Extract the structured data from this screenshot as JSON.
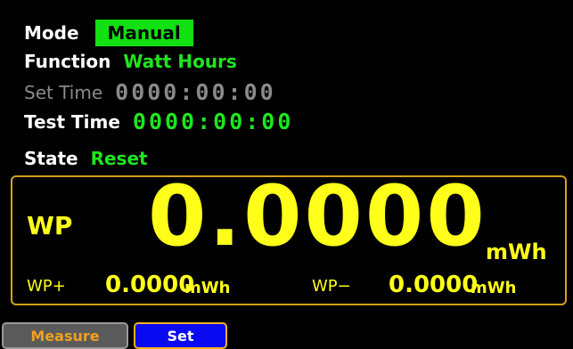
{
  "mode": {
    "label": "Mode",
    "value": "Manual"
  },
  "function": {
    "label": "Function",
    "value": "Watt Hours"
  },
  "set_time": {
    "label": "Set Time",
    "value": "0000:00:00"
  },
  "test_time": {
    "label": "Test Time",
    "value": "0000:00:00"
  },
  "state": {
    "label": "State",
    "value": "Reset"
  },
  "measurement": {
    "main_label": "WP",
    "main_value": "0.0000",
    "main_unit": "mWh",
    "wp_plus_label": "WP+",
    "wp_plus_value": "0.0000",
    "wp_plus_unit": "mWh",
    "wp_minus_label": "WP−",
    "wp_minus_value": "0.0000",
    "wp_minus_unit": "mWh"
  },
  "softkeys": {
    "measure": "Measure",
    "set": "Set"
  },
  "colors": {
    "accent_green": "#1ee61e",
    "value_yellow": "#ffff1a",
    "frame_orange": "#d4a021",
    "set_blue": "#0a0af0"
  }
}
